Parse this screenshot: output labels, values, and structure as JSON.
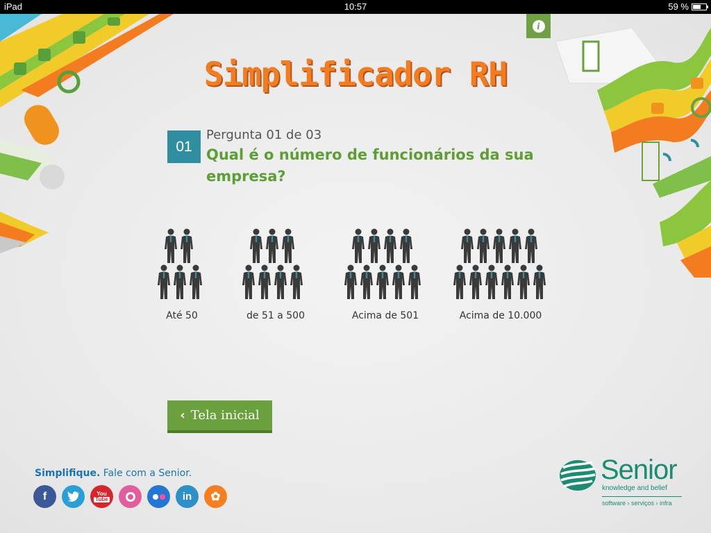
{
  "status_bar": {
    "device": "iPad",
    "time": "10:57",
    "battery": "59 %"
  },
  "app": {
    "title": "Simplificador RH",
    "info_icon": "info-icon"
  },
  "question": {
    "number": "01",
    "counter": "Pergunta 01 de 03",
    "text": "Qual é o número de funcionários da sua empresa?"
  },
  "options": [
    {
      "label": "Até 50",
      "icon": "people-group-icon"
    },
    {
      "label": "de 51 a 500",
      "icon": "people-group-icon"
    },
    {
      "label": "Acima de 501",
      "icon": "people-group-icon"
    },
    {
      "label": "Acima de 10.000",
      "icon": "people-group-icon"
    }
  ],
  "back_button": {
    "label": "Tela inicial",
    "icon": "chevron-left-icon"
  },
  "footer": {
    "tagline_bold": "Simplifique.",
    "tagline_rest": " Fale com a Senior.",
    "social": [
      {
        "name": "facebook",
        "glyph": "f",
        "color": "#3b5998"
      },
      {
        "name": "twitter",
        "glyph": "t",
        "color": "#2a9fd6"
      },
      {
        "name": "youtube",
        "glyph": "You\nTube",
        "color": "#d6262b"
      },
      {
        "name": "orkut",
        "glyph": "o",
        "color": "#e35d9c"
      },
      {
        "name": "flickr",
        "glyph": "••",
        "color": "#2376d4"
      },
      {
        "name": "linkedin",
        "glyph": "in",
        "color": "#2f8fc9"
      },
      {
        "name": "mix",
        "glyph": "✿",
        "color": "#f57f20"
      }
    ]
  },
  "logo": {
    "brand": "Senior",
    "slogan": "knowledge and belief",
    "sub": "software › serviços › infra"
  },
  "colors": {
    "accent_orange": "#f47c20",
    "accent_green": "#6aa03d",
    "teal": "#2f8fa0",
    "brand_green": "#1a8c73"
  }
}
